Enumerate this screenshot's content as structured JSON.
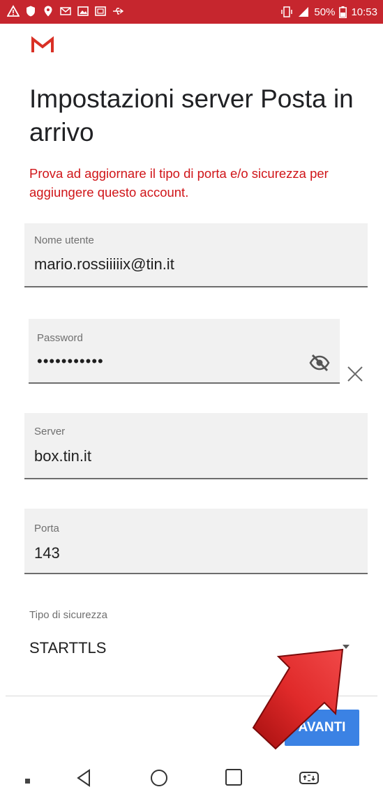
{
  "status_bar": {
    "battery_percent": "50%",
    "time": "10:53",
    "left_icons": [
      "warning-icon",
      "shield-icon",
      "location-icon",
      "email-notification-icon",
      "gallery-icon",
      "image-icon",
      "usb-icon"
    ],
    "right_icons": [
      "vibrate-icon",
      "signal-icon",
      "battery-icon"
    ]
  },
  "app": {
    "logo": "gmail-logo",
    "title": "Impostazioni server Posta in arrivo",
    "error_message": "Prova ad aggiornare il tipo di porta e/o sicurezza per aggiungere questo account."
  },
  "form": {
    "username": {
      "label": "Nome utente",
      "value": "mario.rossiiiiix@tin.it"
    },
    "password": {
      "label": "Password",
      "value": "•••••••••••"
    },
    "server": {
      "label": "Server",
      "value": "box.tin.it"
    },
    "port": {
      "label": "Porta",
      "value": "143"
    },
    "security": {
      "label": "Tipo di sicurezza",
      "value": "STARTTLS"
    }
  },
  "actions": {
    "next_label": "AVANTI"
  },
  "nav_bar": {
    "icons": [
      "nav-dot-icon",
      "back-icon",
      "home-icon",
      "recents-icon",
      "app-switch-icon"
    ]
  },
  "colors": {
    "status_bar": "#c6262e",
    "error_text": "#d01519",
    "button": "#3b82e4",
    "field_bg": "#f1f1f1",
    "annotation_arrow": "#d21f1f"
  }
}
